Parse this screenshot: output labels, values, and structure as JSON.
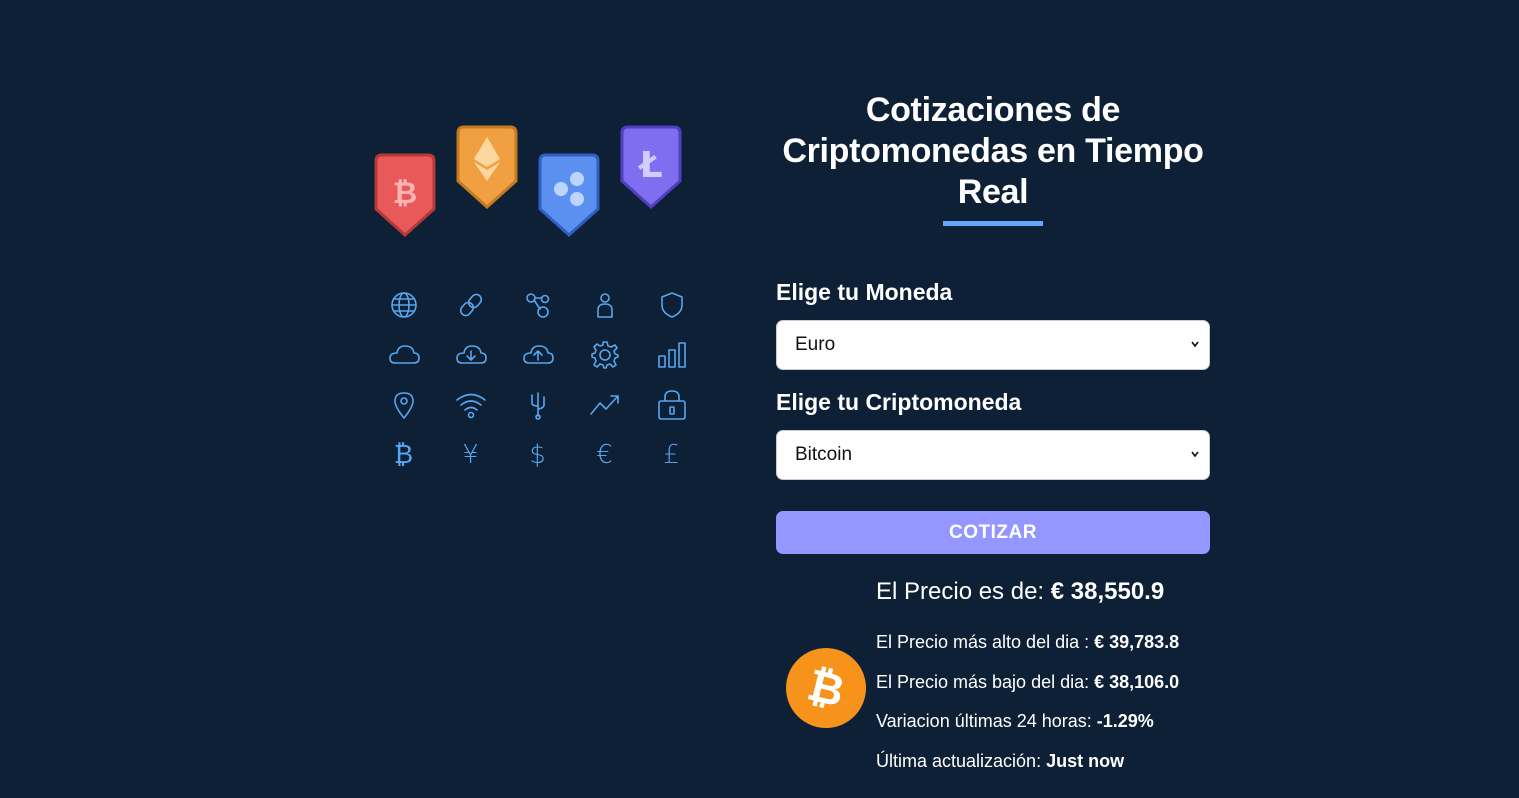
{
  "colors": {
    "background": "#0d2035",
    "accent": "#66a2fe",
    "button": "#9497ff",
    "icon_stroke": "#58a6ef",
    "bitcoin_orange": "#f7931a"
  },
  "illustration": {
    "badges": [
      {
        "icon": "bitcoin-icon",
        "color": "#e85a5a"
      },
      {
        "icon": "ethereum-icon",
        "color": "#f0a040"
      },
      {
        "icon": "ripple-icon",
        "color": "#5b8ff0"
      },
      {
        "icon": "litecoin-icon",
        "color": "#7f6ff0"
      }
    ],
    "icons": [
      "globe-icon",
      "link-icon",
      "network-icon",
      "user-icon",
      "shield-icon",
      "cloud-icon",
      "cloud-download-icon",
      "cloud-upload-icon",
      "gear-icon",
      "bar-chart-icon",
      "location-pin-icon",
      "wifi-icon",
      "usb-icon",
      "trend-up-icon",
      "lock-icon",
      "bitcoin-symbol-icon",
      "yen-icon",
      "dollar-icon",
      "euro-icon",
      "pound-icon"
    ],
    "currency_glyphs": [
      "₿",
      "¥",
      "$",
      "€",
      "£"
    ]
  },
  "header": {
    "title": "Cotizaciones de Criptomonedas en Tiempo Real"
  },
  "form": {
    "currency_label": "Elige tu Moneda",
    "currency_value": "Euro",
    "crypto_label": "Elige tu Criptomoneda",
    "crypto_value": "Bitcoin",
    "submit_label": "Cotizar"
  },
  "result": {
    "price_label": "El Precio es de: ",
    "price_value": "€ 38,550.9",
    "high_label": "El Precio más alto del dia : ",
    "high_value": "€ 39,783.8",
    "low_label": "El Precio más bajo del dia: ",
    "low_value": "€ 38,106.0",
    "change_label": "Variacion últimas 24 horas: ",
    "change_value": "-1.29%",
    "updated_label": "Última actualización: ",
    "updated_value": "Just now",
    "coin_icon": "bitcoin-coin-icon"
  }
}
